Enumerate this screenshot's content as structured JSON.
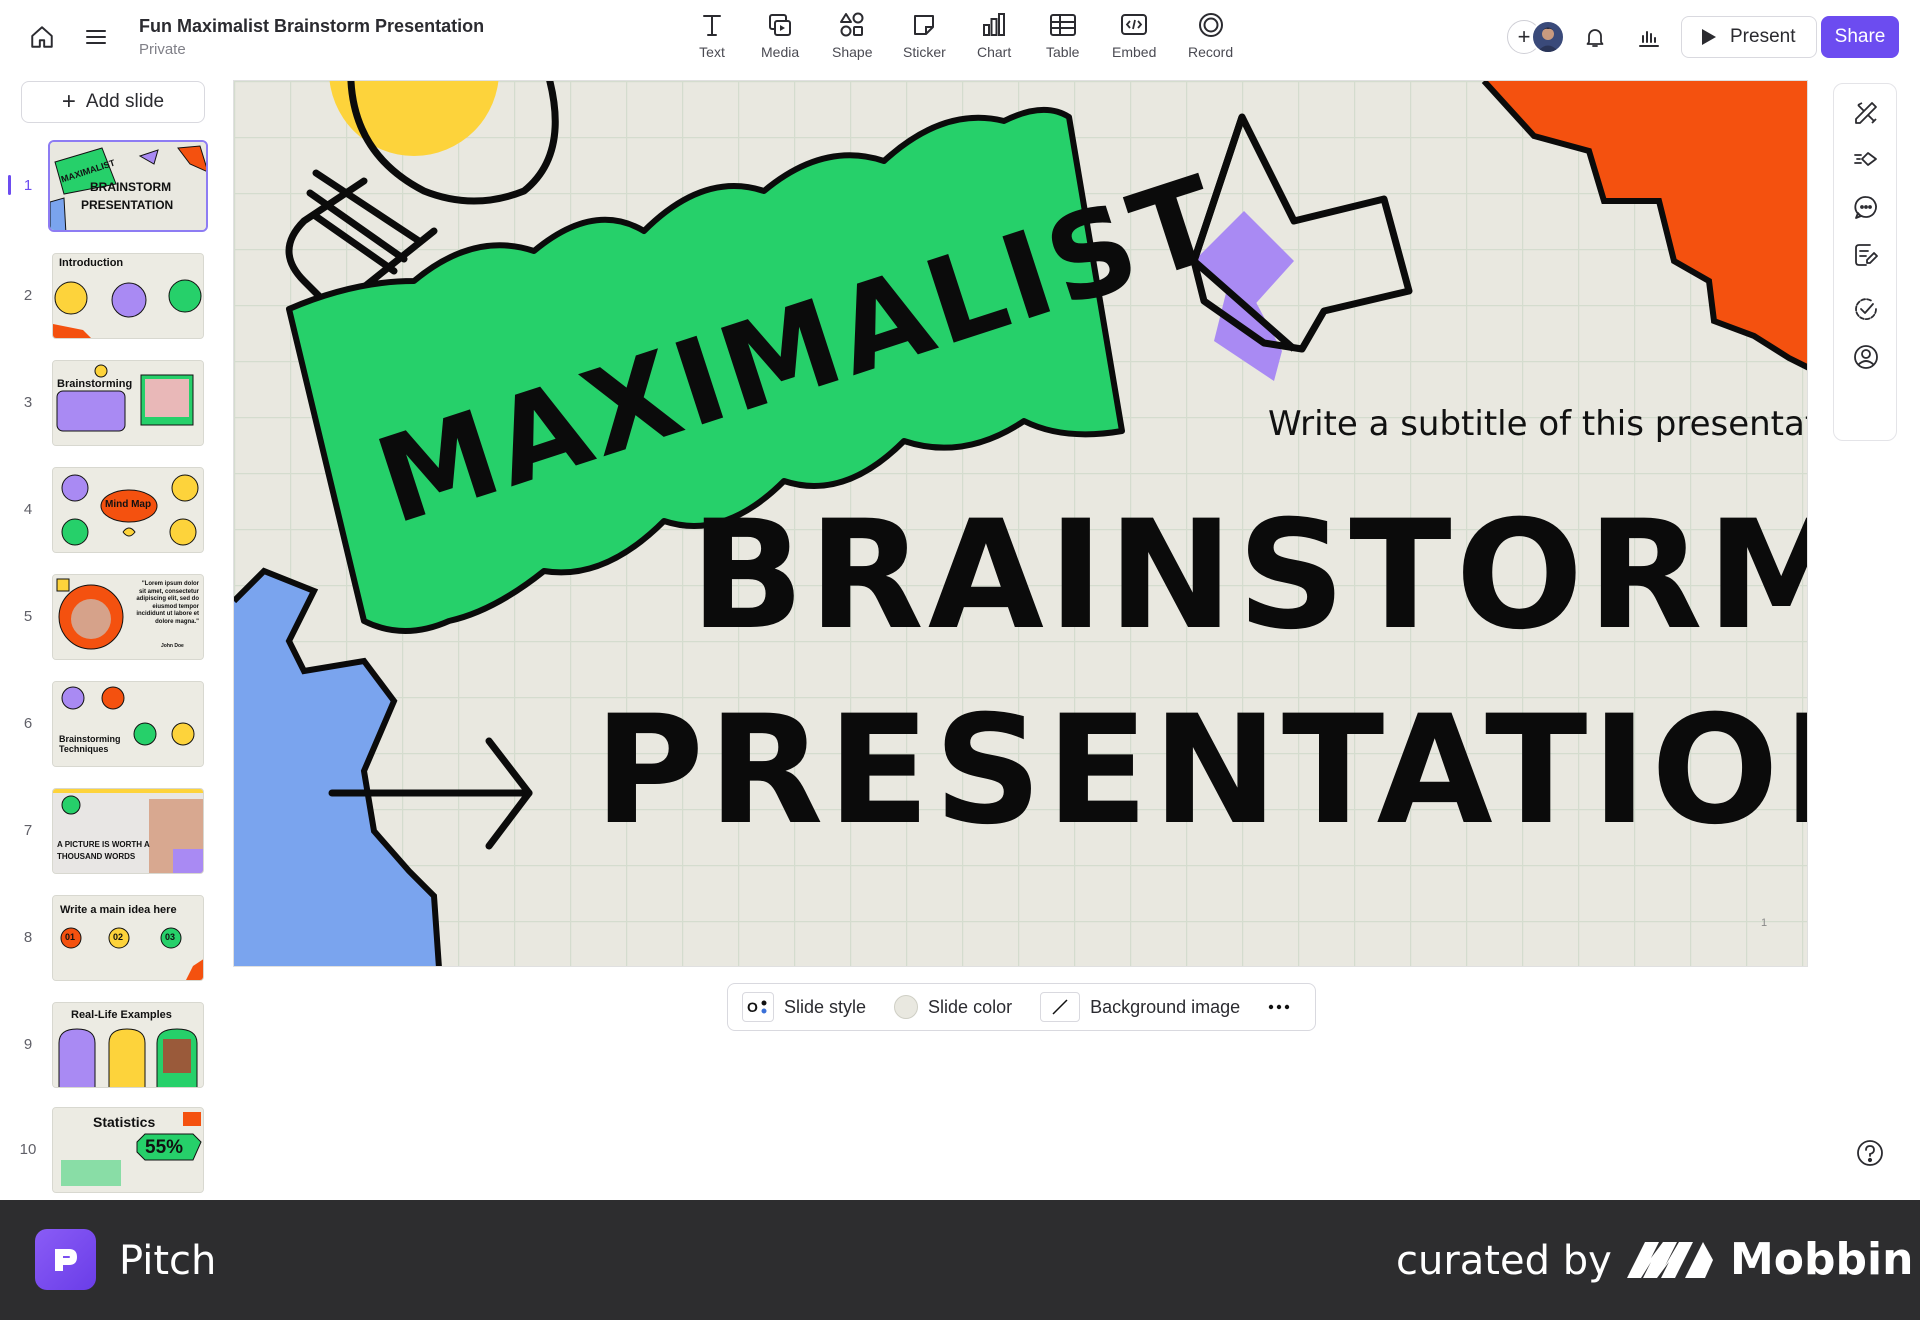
{
  "header": {
    "doc_title": "Fun Maximalist Brainstorm Presentation",
    "doc_privacy": "Private",
    "tools": [
      {
        "label": "Text",
        "icon": "text-icon"
      },
      {
        "label": "Media",
        "icon": "media-icon"
      },
      {
        "label": "Shape",
        "icon": "shape-icon"
      },
      {
        "label": "Sticker",
        "icon": "sticker-icon"
      },
      {
        "label": "Chart",
        "icon": "chart-icon"
      },
      {
        "label": "Table",
        "icon": "table-icon"
      },
      {
        "label": "Embed",
        "icon": "embed-icon"
      },
      {
        "label": "Record",
        "icon": "record-icon"
      }
    ],
    "present_label": "Present",
    "share_label": "Share",
    "accent_color": "#6c4cf0"
  },
  "sidebar": {
    "add_slide_label": "Add slide",
    "slides": [
      {
        "num": "1",
        "title_a": "MAXIMALIST",
        "title_b": "BRAINSTORM",
        "title_c": "PRESENTATION",
        "active": true
      },
      {
        "num": "2",
        "title_a": "Introduction"
      },
      {
        "num": "3",
        "title_a": "Brainstorming"
      },
      {
        "num": "4",
        "title_a": "Mind Map"
      },
      {
        "num": "5",
        "title_a": "\"Lorem ipsum dolor sit amet, consectetur adipiscing elit, sed do eiusmod tempor incididunt ut labore et dolore magna.\"",
        "title_b": "John Doe"
      },
      {
        "num": "6",
        "title_a": "Brainstorming Techniques"
      },
      {
        "num": "7",
        "title_a": "A PICTURE IS WORTH A THOUSAND WORDS"
      },
      {
        "num": "8",
        "title_a": "Write a main idea here",
        "title_b": "01",
        "title_c": "02",
        "title_d": "03"
      },
      {
        "num": "9",
        "title_a": "Real-Life Examples"
      },
      {
        "num": "10",
        "title_a": "Statistics",
        "title_b": "55%"
      }
    ]
  },
  "slide": {
    "sticker_text": "MAXIMALIST",
    "subtitle": "Write a subtitle of this presentation",
    "title_line1": "BRAINSTORM",
    "title_line2": "PRESENTATION",
    "page_number": "1",
    "colors": {
      "background": "#e9e8e0",
      "green": "#26d06a",
      "orange": "#f4510f",
      "blue": "#7aa4ee",
      "purple": "#a98af3",
      "yellow": "#fdd33b"
    }
  },
  "slide_toolbar": {
    "style_label": "Slide style",
    "color_label": "Slide color",
    "background_label": "Background image",
    "more_icon": "more-icon"
  },
  "right_rail": {
    "icons": [
      "design-tools-icon",
      "animation-icon",
      "comments-icon",
      "notes-icon",
      "checklist-icon",
      "profile-icon"
    ]
  },
  "footer": {
    "app_name": "Pitch",
    "curated_label": "curated by",
    "brand": "Mobbin"
  }
}
